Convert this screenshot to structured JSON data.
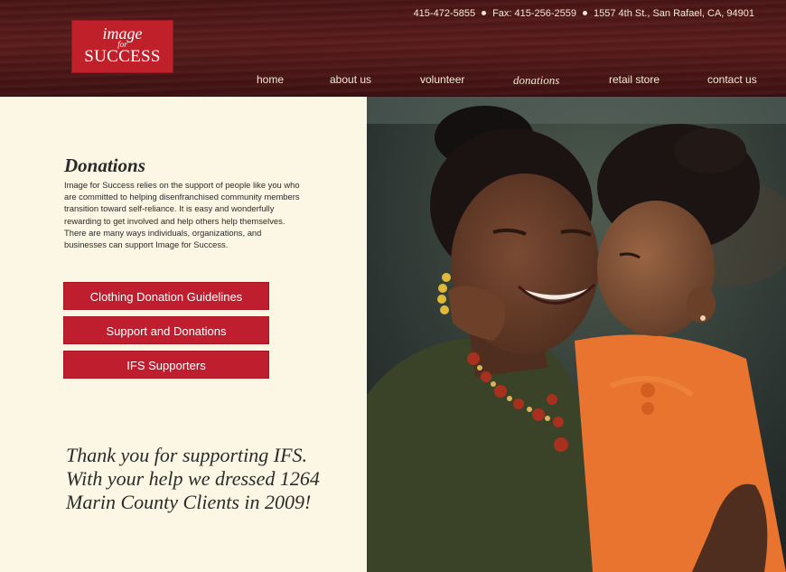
{
  "header": {
    "logo": {
      "line1": "image",
      "line2": "for",
      "line3": "SUCCESS"
    },
    "phone": "415-472-5855",
    "fax": "Fax: 415-256-2559",
    "address": "1557 4th St., San Rafael, CA, 94901",
    "nav": [
      {
        "label": "home"
      },
      {
        "label": "about us"
      },
      {
        "label": "volunteer"
      },
      {
        "label": "donations",
        "active": true
      },
      {
        "label": "retail store"
      },
      {
        "label": "contact us"
      }
    ]
  },
  "main": {
    "title": "Donations",
    "body": "Image for Success relies on the support of people like you who are committed to helping disenfranchised community members transition toward self-reliance. It is easy and wonderfully rewarding to get involved and help others help themselves. There are many ways individuals, organizations, and businesses can support Image for Success.",
    "buttons": [
      {
        "label": "Clothing Donation Guidelines"
      },
      {
        "label": "Support and Donations"
      },
      {
        "label": "IFS Supporters"
      }
    ],
    "thanks_line1": "Thank you for supporting IFS.",
    "thanks_line2": "With your help we dressed 1264",
    "thanks_line3": "Marin County Clients in 2009!"
  },
  "colors": {
    "header_bg": "#4a1516",
    "accent_red": "#be1e2d",
    "panel_bg": "#fbf7e4",
    "nav_text": "#f3e9d6"
  }
}
